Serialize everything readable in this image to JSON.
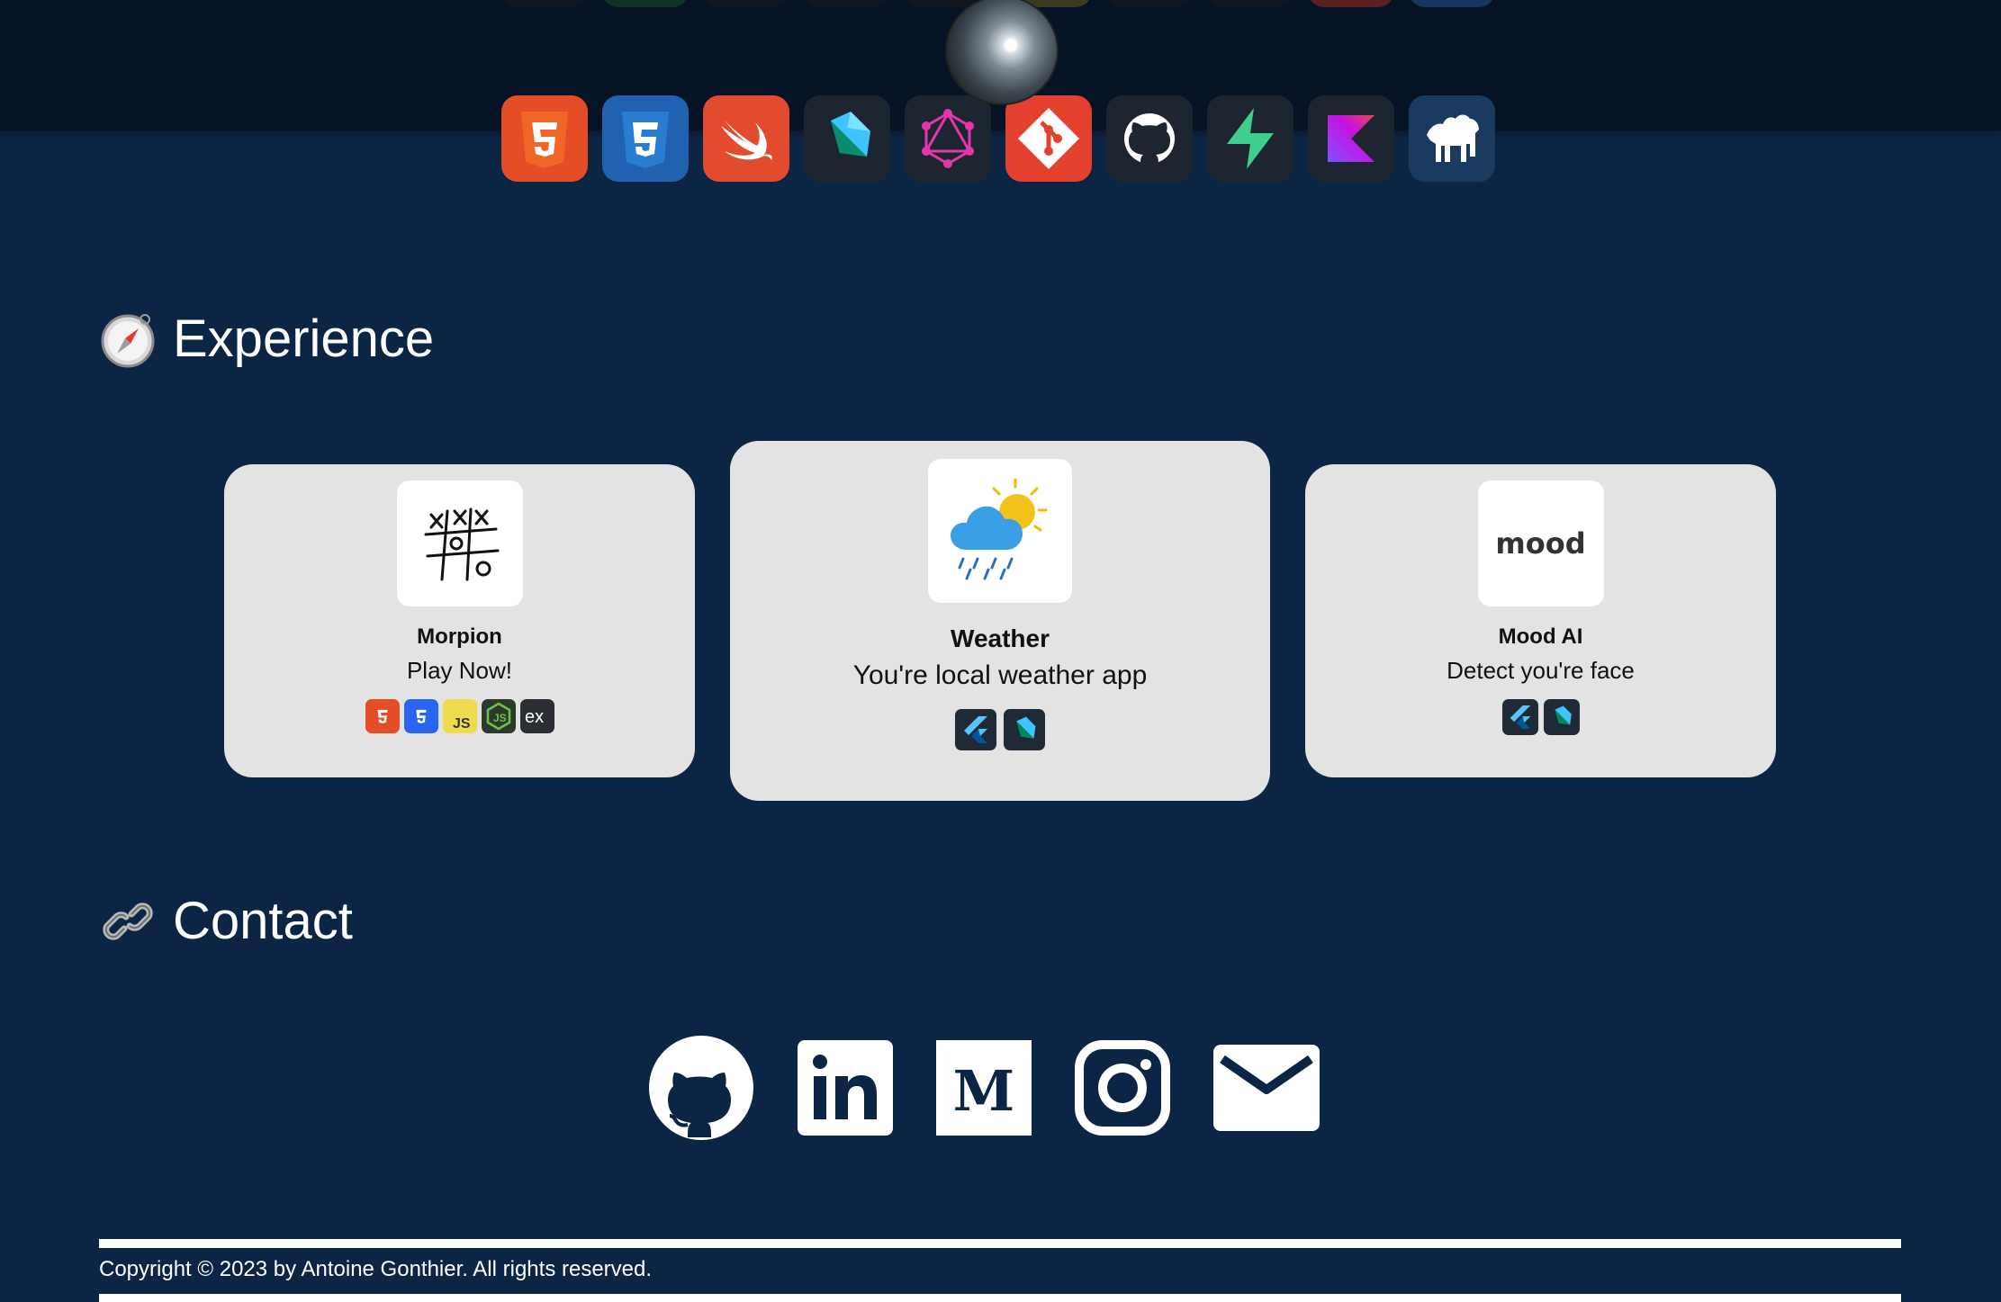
{
  "tech_stack": {
    "icons": [
      "html5-icon",
      "css3-icon",
      "swift-icon",
      "dart-icon",
      "graphql-icon",
      "git-icon",
      "github-icon",
      "supabase-icon",
      "kotlin-icon",
      "perl-icon"
    ],
    "colors": {
      "html5": "#e44d26",
      "css3": "#2965f1",
      "swift": "#f05138",
      "git": "#f05033",
      "supabase": "#3ecf8e"
    }
  },
  "experience": {
    "title": "Experience",
    "icon": "compass-icon",
    "projects": [
      {
        "name": "Morpion",
        "description": "Play Now!",
        "logo": "tic-tac-toe-icon",
        "tags": [
          "html5-icon",
          "css3-icon",
          "javascript-icon",
          "nodejs-icon",
          "express-icon"
        ]
      },
      {
        "name": "Weather",
        "description": "You're local weather app",
        "logo": "weather-icon",
        "tags": [
          "flutter-icon",
          "dart-icon"
        ]
      },
      {
        "name": "Mood AI",
        "description": "Detect you're face",
        "logo_text": "mood",
        "tags": [
          "flutter-icon",
          "dart-icon"
        ]
      }
    ]
  },
  "contact": {
    "title": "Contact",
    "icon": "link-icon",
    "links": [
      "github-icon",
      "linkedin-icon",
      "medium-icon",
      "instagram-icon",
      "mail-icon"
    ]
  },
  "footer": {
    "copyright": "Copyright © 2023 by Antoine Gonthier. All rights reserved."
  }
}
